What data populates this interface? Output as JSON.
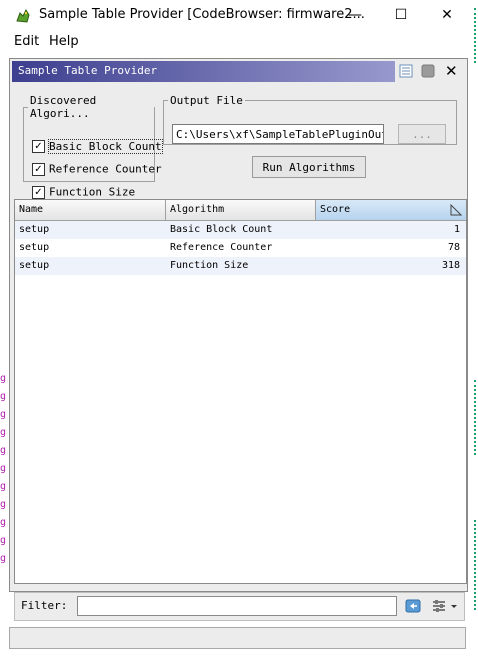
{
  "window": {
    "title": "Sample Table Provider [CodeBrowser: firmware2...",
    "minimize": "—",
    "maximize": "☐",
    "close": "✕"
  },
  "menu": {
    "edit": "Edit",
    "help": "Help"
  },
  "panel": {
    "title": "Sample Table Provider",
    "close_glyph": "✕"
  },
  "algorithms": {
    "legend": "Discovered Algori...",
    "items": [
      {
        "label": "Basic Block Count",
        "checked": true
      },
      {
        "label": "Reference Counter",
        "checked": true
      },
      {
        "label": "Function Size",
        "checked": true
      }
    ]
  },
  "output": {
    "legend": "Output File",
    "path": "C:\\Users\\xf\\SampleTablePluginOutput",
    "browse_label": "..."
  },
  "run_button": "Run Algorithms",
  "table": {
    "columns": [
      "Name",
      "Algorithm",
      "Score"
    ],
    "sorted_column": "Score",
    "rows": [
      {
        "name": "setup",
        "algorithm": "Basic Block Count",
        "score": "1"
      },
      {
        "name": "setup",
        "algorithm": "Reference Counter",
        "score": "78"
      },
      {
        "name": "setup",
        "algorithm": "Function Size",
        "score": "318"
      }
    ]
  },
  "filter": {
    "label": "Filter:",
    "value": "",
    "placeholder": ""
  },
  "colors": {
    "header_gradient_start": "#3d3f8f",
    "header_gradient_end": "#a8a9d8",
    "row_alt": "#eef2fb",
    "sorted_column": "#b6d3ee"
  }
}
